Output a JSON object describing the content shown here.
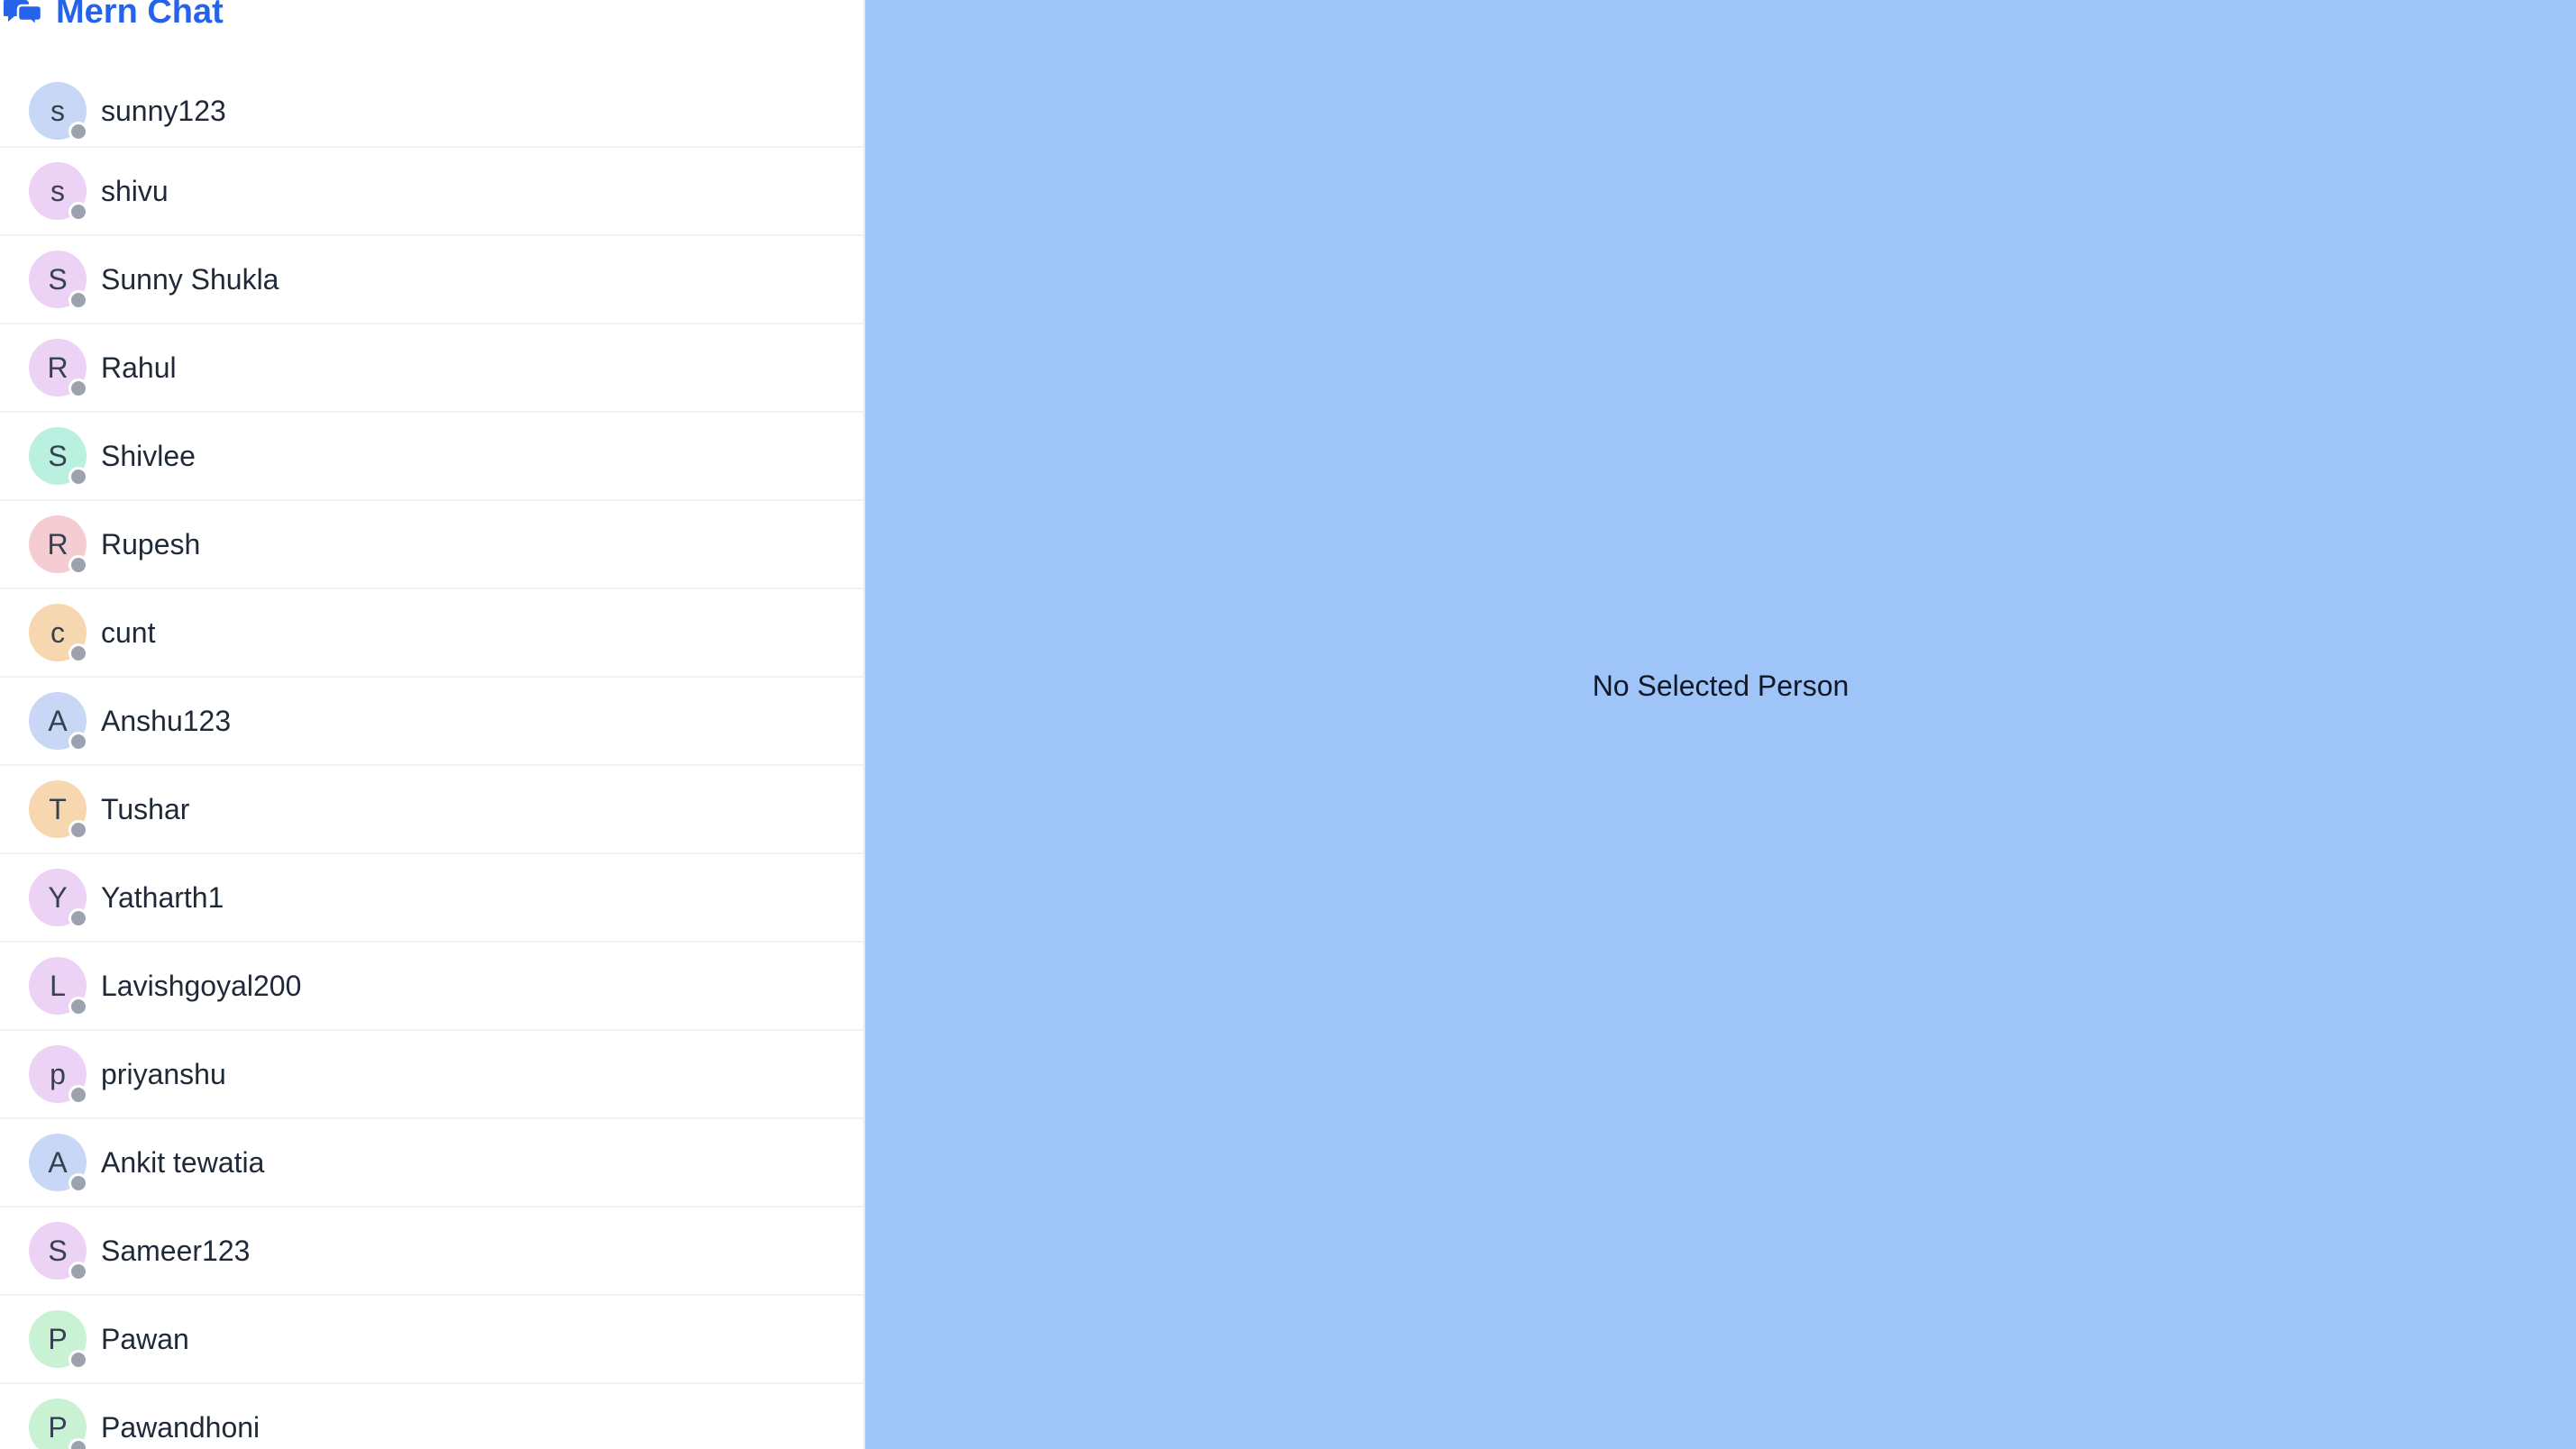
{
  "brand": {
    "title": "Mern Chat",
    "icon": "chat-bubbles-icon",
    "color": "#2563eb"
  },
  "contacts": [
    {
      "initial": "s",
      "name": "sunny123",
      "avatar_bg": "#c7d7f5"
    },
    {
      "initial": "s",
      "name": "shivu",
      "avatar_bg": "#ecd2f5"
    },
    {
      "initial": "S",
      "name": "Sunny Shukla",
      "avatar_bg": "#ecd2f5"
    },
    {
      "initial": "R",
      "name": "Rahul",
      "avatar_bg": "#ecd2f5"
    },
    {
      "initial": "S",
      "name": "Shivlee",
      "avatar_bg": "#b9f0df"
    },
    {
      "initial": "R",
      "name": "Rupesh",
      "avatar_bg": "#f5ccd1"
    },
    {
      "initial": "c",
      "name": "cunt",
      "avatar_bg": "#f7d7b0"
    },
    {
      "initial": "A",
      "name": "Anshu123",
      "avatar_bg": "#c7d7f5"
    },
    {
      "initial": "T",
      "name": "Tushar",
      "avatar_bg": "#f7d7b0"
    },
    {
      "initial": "Y",
      "name": "Yatharth1",
      "avatar_bg": "#ecd2f5"
    },
    {
      "initial": "L",
      "name": "Lavishgoyal200",
      "avatar_bg": "#ecd2f5"
    },
    {
      "initial": "p",
      "name": "priyanshu",
      "avatar_bg": "#ecd2f5"
    },
    {
      "initial": "A",
      "name": "Ankit tewatia",
      "avatar_bg": "#c7d7f5"
    },
    {
      "initial": "S",
      "name": "Sameer123",
      "avatar_bg": "#ecd2f5"
    },
    {
      "initial": "P",
      "name": "Pawan",
      "avatar_bg": "#c9f2d4"
    },
    {
      "initial": "P",
      "name": "Pawandhoni",
      "avatar_bg": "#c9f2d4"
    }
  ],
  "main": {
    "empty_text": "No Selected Person",
    "background": "#9fc4f8"
  },
  "status": {
    "offline_color": "#9ca3af"
  }
}
